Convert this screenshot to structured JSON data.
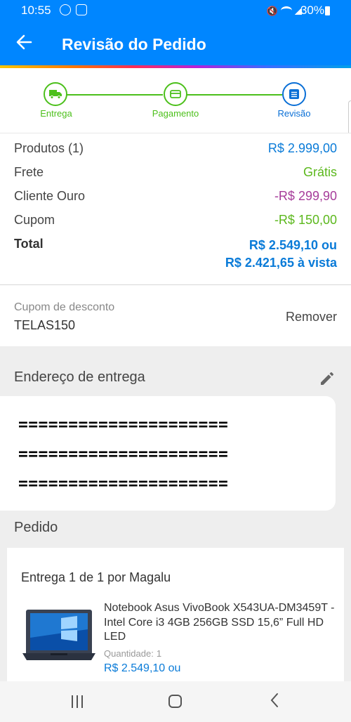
{
  "status_bar": {
    "time": "10:55",
    "battery": "30%",
    "icons": [
      "whatsapp-icon",
      "samsung-icon",
      "mute-icon",
      "wifi-icon",
      "signal-icon",
      "battery-icon"
    ]
  },
  "header": {
    "back_icon": "arrow-left-icon",
    "title": "Revisão do Pedido",
    "bar_color": "#0086ff"
  },
  "stepper": {
    "steps": [
      {
        "label": "Entrega",
        "icon": "truck-icon",
        "state": "done"
      },
      {
        "label": "Pagamento",
        "icon": "card-icon",
        "state": "done"
      },
      {
        "label": "Revisão",
        "icon": "list-icon",
        "state": "active"
      }
    ],
    "done_color": "#4cc01b",
    "active_color": "#0a6fd6"
  },
  "summary": {
    "rows": [
      {
        "label": "Produtos (1)",
        "value": "R$ 2.999,00"
      },
      {
        "label": "Frete",
        "value": "Grátis"
      },
      {
        "label": "Cliente Ouro",
        "value": "-R$ 299,90"
      },
      {
        "label": "Cupom",
        "value": "-R$ 150,00"
      }
    ],
    "total": {
      "label": "Total",
      "value_line1": "R$ 2.549,10 ou",
      "value_line2": "R$ 2.421,65 à vista"
    }
  },
  "coupon": {
    "label": "Cupom de desconto",
    "code": "TELAS150",
    "remove_label": "Remover"
  },
  "address": {
    "heading": "Endereço de entrega",
    "edit_icon": "pencil-icon",
    "lines": [
      "=====================",
      "=====================",
      "====================="
    ]
  },
  "order": {
    "heading": "Pedido",
    "delivery_label": "Entrega 1 de 1 por Magalu",
    "product": {
      "name": "Notebook Asus VivoBook X543UA-DM3459T - Intel Core i3 4GB 256GB SSD 15,6” Full HD LED",
      "qty_label": "Quantidade:",
      "qty_value": "1",
      "price": "R$ 2.549,10 ou",
      "image_icon": "laptop-image"
    }
  },
  "nav_bar": {
    "icons": [
      "recent-apps-icon",
      "home-icon",
      "back-icon"
    ]
  }
}
